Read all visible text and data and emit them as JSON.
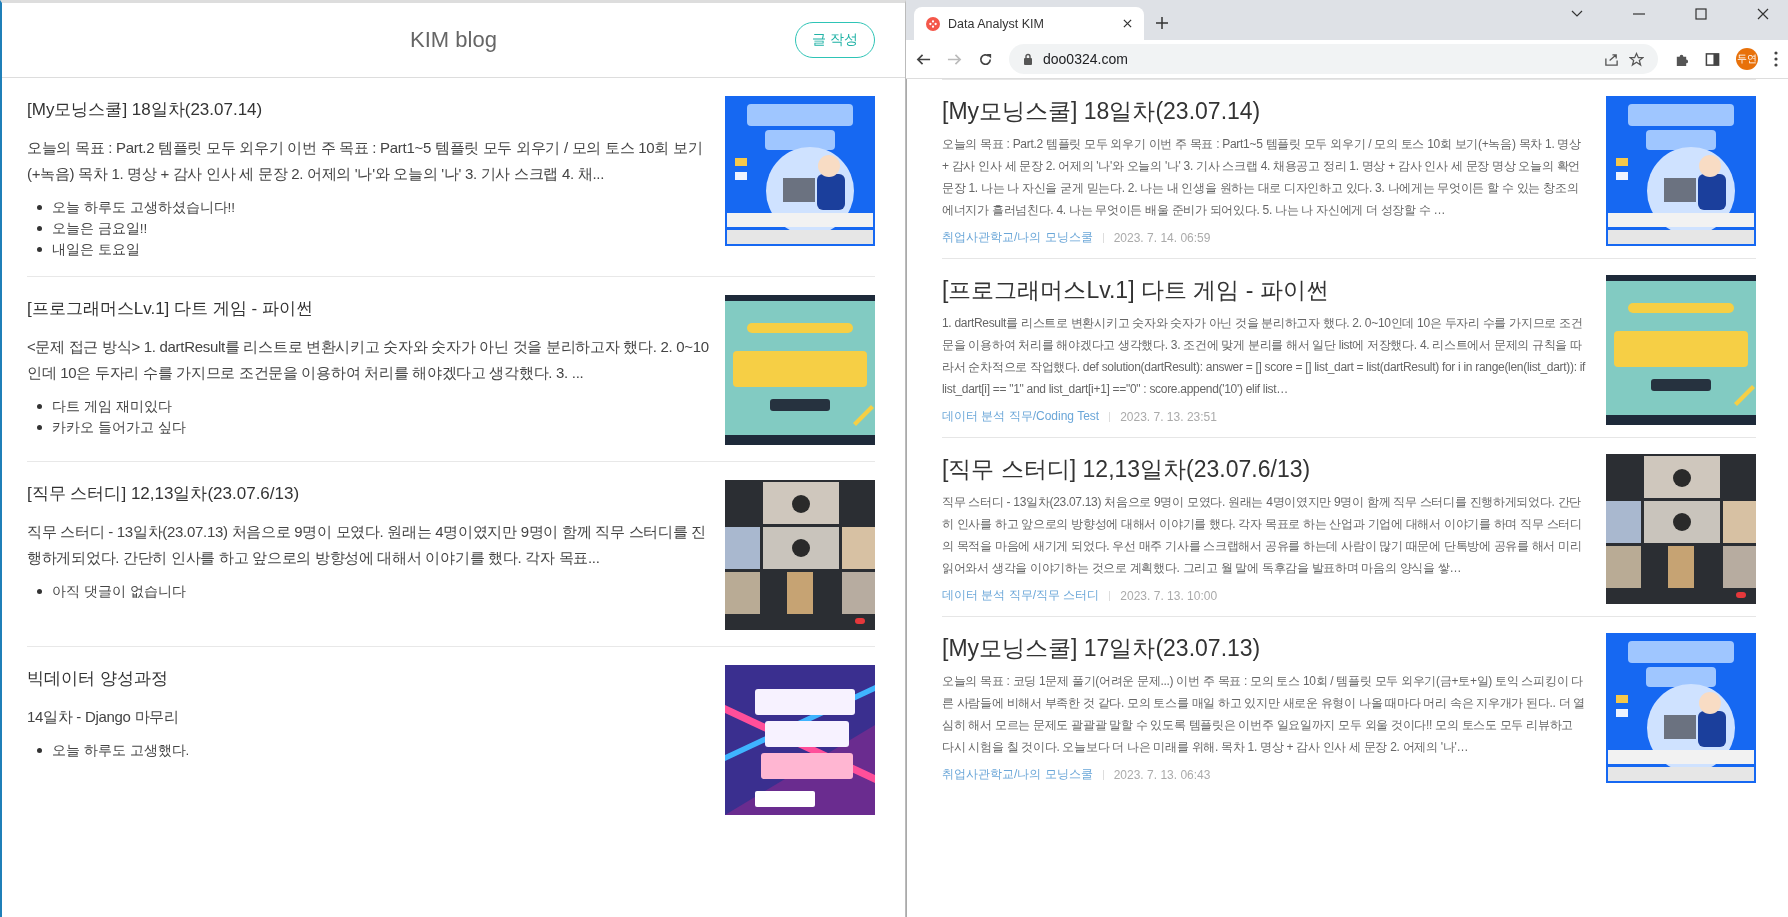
{
  "blog_page": {
    "title": "KIM blog",
    "write_button": "글 작성",
    "posts": [
      {
        "title": "[My모닝스쿨] 18일차(23.07.14)",
        "summary": "오늘의 목표 : Part.2 템플릿 모두 외우기 이번 주 목표 : Part1~5 템플릿 모두 외우기 / 모의 토스 10회 보기(+녹음) 목차 1. 명상 + 감사 인사 세 문장 2. 어제의 '나'와 오늘의 '나' 3. 기사 스크랩 4. 채...",
        "comments": [
          "오늘 하루도 고생하셨습니다!!",
          "오늘은 금요일!!",
          "내일은 토요일"
        ]
      },
      {
        "title": "[프로그래머스Lv.1] 다트 게임 - 파이썬",
        "summary": "<문제 접근 방식> 1. dartResult를 리스트로 변환시키고 숫자와 숫자가 아닌 것을 분리하고자 했다. 2. 0~10인데 10은 두자리 수를 가지므로 조건문을 이용하여 처리를 해야겠다고 생각했다. 3. ...",
        "comments": [
          "다트 게임 재미있다",
          "카카오 들어가고 싶다"
        ]
      },
      {
        "title": "[직무 스터디] 12,13일차(23.07.6/13)",
        "summary": "직무 스터디 - 13일차(23.07.13) 처음으로 9명이 모였다. 원래는 4명이였지만 9명이 함께 직무 스터디를 진행하게되었다. 간단히 인사를 하고 앞으로의 방향성에 대해서 이야기를 했다. 각자 목표...",
        "comments": [
          "아직 댓글이 없습니다"
        ]
      },
      {
        "title": "빅데이터 양성과정",
        "summary": "14일차 - Django 마무리",
        "comments": [
          "오늘 하루도 고생했다."
        ]
      }
    ]
  },
  "browser": {
    "tab": {
      "title": "Data Analyst KIM",
      "selected": true
    },
    "address": "doo0324.com",
    "profile": "두연",
    "posts": [
      {
        "title": "[My모닝스쿨] 18일차(23.07.14)",
        "excerpt": "오늘의 목표 : Part.2 템플릿 모두 외우기 이번 주 목표 : Part1~5 템플릿 모두 외우기 / 모의 토스 10회 보기(+녹음) 목차 1. 명상 + 감사 인사 세 문장 2. 어제의 '나'와 오늘의 '나' 3. 기사 스크랩 4. 채용공고 정리 1. 명상 + 감사 인사 세 문장 명상 오늘의 확언문장 1. 나는 나 자신을 굳게 믿는다. 2. 나는 내 인생을 원하는 대로 디자인하고 있다. 3. 나에게는 무엇이든 할 수 있는 창조의 에너지가 흘러넘친다. 4. 나는 무엇이든 배울 준비가 되어있다. 5. 나는 나 자신에게 더 성장할 수 …",
        "category": "취업사관학교/나의 모닝스쿨",
        "date": "2023. 7. 14. 06:59"
      },
      {
        "title": "[프로그래머스Lv.1] 다트 게임 - 파이썬",
        "excerpt": "1. dartResult를 리스트로 변환시키고 숫자와 숫자가 아닌 것을 분리하고자 했다. 2. 0~10인데 10은 두자리 수를 가지므로 조건문을 이용하여 처리를 해야겠다고 생각했다. 3. 조건에 맞게 분리를 해서 일단 list에 저장했다. 4. 리스트에서 문제의 규칙을 따라서 순차적으로 작업했다. def solution(dartResult): answer = [] score = [] list_dart = list(dartResult) for i in range(len(list_dart)): if list_dart[i] == \"1\" and list_dart[i+1] ==\"0\" : score.append('10') elif list…",
        "category": "데이터 분석 직무/Coding Test",
        "date": "2023. 7. 13. 23:51"
      },
      {
        "title": "[직무 스터디] 12,13일차(23.07.6/13)",
        "excerpt": "직무 스터디 - 13일차(23.07.13) 처음으로 9명이 모였다. 원래는 4명이였지만 9명이 함께 직무 스터디를 진행하게되었다. 간단히 인사를 하고 앞으로의 방향성에 대해서 이야기를 했다. 각자 목표로 하는 산업과 기업에 대해서 이야기를 하며 직무 스터디의 목적을 마음에 새기게 되었다. 우선 매주 기사를 스크랩해서 공유를 하는데 사람이 많기 때문에 단톡방에 공유를 해서 미리 읽어와서 생각을 이야기하는 것으로 계획했다. 그리고 월 말에 독후감을 발표하며 마음의 양식을 쌓…",
        "category": "데이터 분석 직무/직무 스터디",
        "date": "2023. 7. 13. 10:00"
      },
      {
        "title": "[My모닝스쿨] 17일차(23.07.13)",
        "excerpt": "오늘의 목표 : 코딩 1문제 풀기(어려운 문제...) 이번 주 목표 : 모의 토스 10회 / 템플릿 모두 외우기(금+토+일) 토익 스피킹이 다른 사람들에 비해서 부족한 것 같다. 모의 토스를 매일 하고 있지만 새로운 유형이 나올 때마다 머리 속은 지우개가 된다.. 더 열심히 해서 모르는 문제도 괄괄괄 말할 수 있도록 템플릿은 이번주 일요일까지 모두 외울 것이다!! 모의 토스도 모두 리뷰하고 다시 시험을 칠 것이다. 오늘보다 더 나은 미래를 위해. 목차 1. 명상 + 감사 인사 세 문장 2. 어제의 '나'…",
        "category": "취업사관학교/나의 모닝스쿨",
        "date": "2023. 7. 13. 06:43"
      }
    ]
  }
}
